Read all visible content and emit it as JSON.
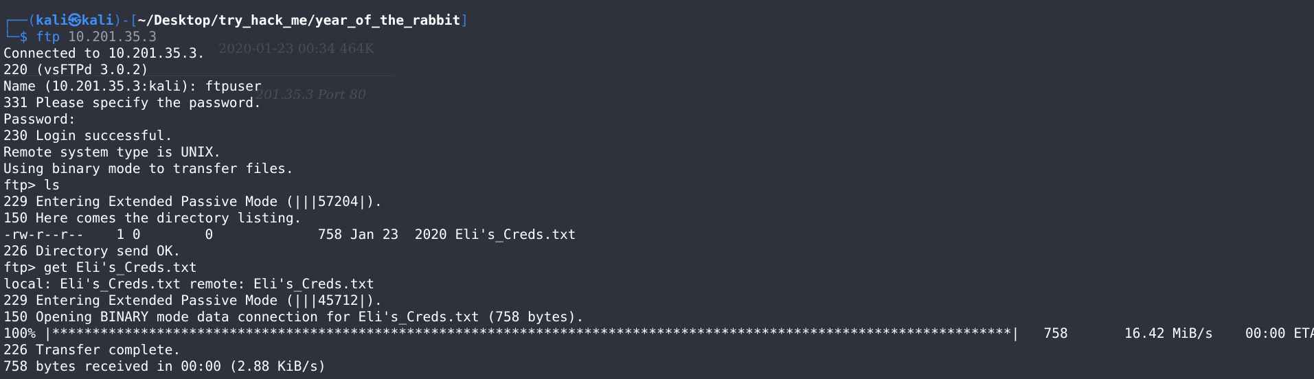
{
  "prompt": {
    "frame_top_left": "┌──(",
    "user": "kali",
    "at_symbol": "㉿",
    "host": "kali",
    "frame_mid": ")-[",
    "path": "~/Desktop/try_hack_me/year_of_the_rabbit",
    "frame_close": "]",
    "frame_bottom": "└─",
    "dollar": "$",
    "command": "ftp",
    "argument": "10.201.35.3"
  },
  "output_lines": [
    "Connected to 10.201.35.3.",
    "220 (vsFTPd 3.0.2)",
    "Name (10.201.35.3:kali): ftpuser",
    "331 Please specify the password.",
    "Password: ",
    "230 Login successful.",
    "Remote system type is UNIX.",
    "Using binary mode to transfer files.",
    "ftp> ls",
    "229 Entering Extended Passive Mode (|||57204|).",
    "150 Here comes the directory listing.",
    "-rw-r--r--    1 0        0             758 Jan 23  2020 Eli's_Creds.txt",
    "226 Directory send OK.",
    "ftp> get Eli's_Creds.txt",
    "local: Eli's_Creds.txt remote: Eli's_Creds.txt",
    "229 Entering Extended Passive Mode (|||45712|).",
    "150 Opening BINARY mode data connection for Eli's_Creds.txt (758 bytes).",
    "100% |***********************************************************************************************************************|   758       16.42 MiB/s    00:00 ETA",
    "226 Transfer complete.",
    "758 bytes received in 00:00 (2.88 KiB/s)"
  ],
  "background_ghost": {
    "text_1": "2020-01-23 00:34 464K",
    "text_2": "201.35.3 Port 80"
  },
  "colors": {
    "background": "#2f323d",
    "text": "#ffffff",
    "prompt_blue": "#3f8ff5",
    "frame_blue": "#3b7de0",
    "argument_gray": "#9aa0aa"
  }
}
